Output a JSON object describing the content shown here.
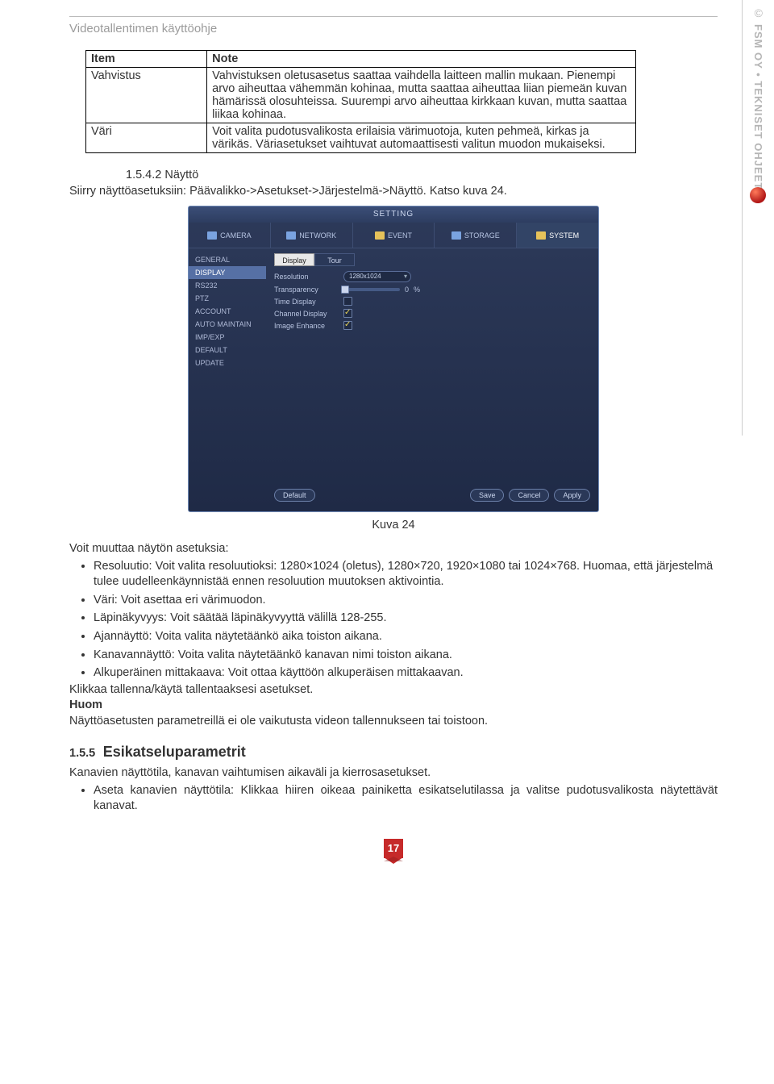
{
  "doc_title": "Videotallentimen käyttöohje",
  "right_rail": {
    "copyright": "©",
    "brand": "FSM OY • TEKNISET OHJEET"
  },
  "table": {
    "header": [
      "Item",
      "Note"
    ],
    "rows": [
      {
        "item": "Vahvistus",
        "note": "Vahvistuksen oletusasetus saattaa vaihdella laitteen mallin mukaan. Pienempi arvo aiheuttaa vähemmän kohinaa, mutta saattaa aiheuttaa liian piemeän kuvan hämärissä olosuhteissa. Suurempi arvo aiheuttaa kirkkaan kuvan, mutta saattaa liikaa kohinaa."
      },
      {
        "item": "Väri",
        "note": "Voit valita pudotusvalikosta erilaisia värimuotoja, kuten pehmeä, kirkas ja värikäs. Väriasetukset vaihtuvat automaattisesti valitun muodon mukaiseksi."
      }
    ]
  },
  "section_num": "1.5.4.2 Näyttö",
  "section_line": "Siirry näyttöasetuksiin: Päävalikko->Asetukset->Järjestelmä->Näyttö. Katso kuva 24.",
  "window": {
    "title": "SETTING",
    "tabs": [
      "CAMERA",
      "NETWORK",
      "EVENT",
      "STORAGE",
      "SYSTEM"
    ],
    "active_tab": 4,
    "sidebar": [
      "GENERAL",
      "DISPLAY",
      "RS232",
      "PTZ",
      "ACCOUNT",
      "AUTO MAINTAIN",
      "IMP/EXP",
      "DEFAULT",
      "UPDATE"
    ],
    "sidebar_sel": 1,
    "subtabs": [
      "Display",
      "Tour"
    ],
    "subtab_sel": 0,
    "fields": {
      "resolution": "Resolution",
      "resolution_val": "1280x1024",
      "transparency": "Transparency",
      "transparency_val": "0",
      "transparency_unit": "%",
      "time_display": "Time Display",
      "channel_display": "Channel Display",
      "image_enhance": "Image Enhance"
    },
    "buttons": {
      "default": "Default",
      "save": "Save",
      "cancel": "Cancel",
      "apply": "Apply"
    }
  },
  "caption": "Kuva 24",
  "change_intro": "Voit muuttaa näytön asetuksia:",
  "bullets1": [
    "Resoluutio: Voit valita resoluutioksi: 1280×1024 (oletus), 1280×720, 1920×1080 tai 1024×768. Huomaa, että järjestelmä tulee uudelleenkäynnistää ennen resoluution muutoksen aktivointia.",
    "Väri: Voit asettaa eri värimuodon.",
    "Läpinäkyvyys: Voit säätää läpinäkyvyyttä välillä 128-255.",
    "Ajannäyttö: Voita valita näytetäänkö aika toiston aikana.",
    "Kanavannäyttö: Voita valita näytetäänkö kanavan nimi toiston aikana.",
    "Alkuperäinen mittakaava: Voit ottaa käyttöön alkuperäisen mittakaavan."
  ],
  "after1": "Klikkaa tallenna/käytä tallentaaksesi asetukset.",
  "huom_label": "Huom",
  "huom_text": "Näyttöasetusten parametreillä ei ole vaikutusta videon tallennukseen tai toistoon.",
  "h155_num": "1.5.5",
  "h155_title": "Esikatseluparametrit",
  "h155_intro": "Kanavien näyttötila, kanavan vaihtumisen aikaväli ja kierrosasetukset.",
  "bullets2": [
    "Aseta kanavien näyttötila: Klikkaa hiiren oikeaa painiketta esikatselutilassa ja valitse pudotusvalikosta näytettävät kanavat."
  ],
  "page_number": "17"
}
